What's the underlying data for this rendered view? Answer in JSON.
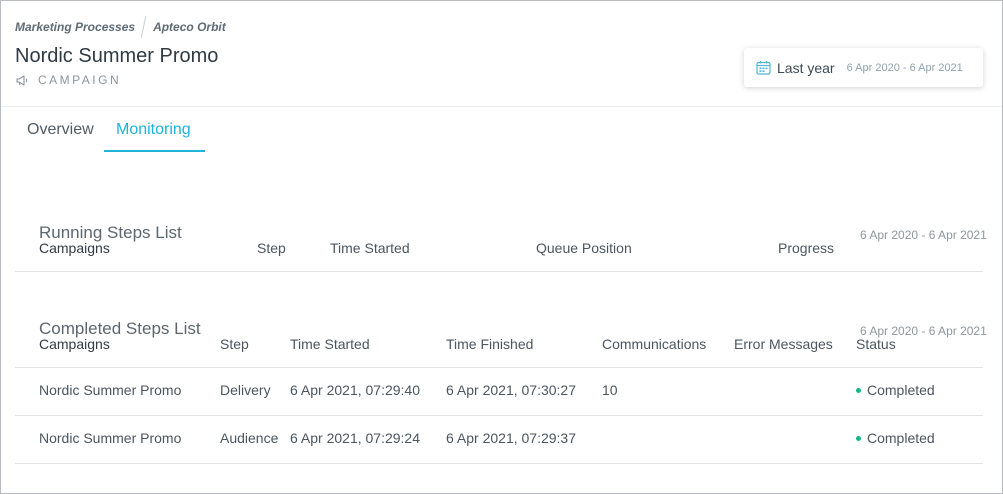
{
  "breadcrumb": [
    "Marketing Processes",
    "Apteco Orbit"
  ],
  "page": {
    "title": "Nordic Summer Promo",
    "type_label": "CAMPAIGN"
  },
  "date_filter": {
    "label": "Last year",
    "range": "6 Apr 2020 - 6 Apr 2021"
  },
  "tabs": [
    {
      "label": "Overview",
      "active": false
    },
    {
      "label": "Monitoring",
      "active": true
    }
  ],
  "running": {
    "title": "Running Steps List",
    "range": "6 Apr 2020 - 6 Apr 2021",
    "columns": [
      "Campaigns",
      "Step",
      "Time Started",
      "Queue Position",
      "Progress"
    ]
  },
  "completed": {
    "title": "Completed Steps List",
    "range": "6 Apr 2020 - 6 Apr 2021",
    "columns": [
      "Campaigns",
      "Step",
      "Time Started",
      "Time Finished",
      "Communications",
      "Error Messages",
      "Status"
    ],
    "rows": [
      {
        "campaign": "Nordic Summer Promo",
        "step": "Delivery",
        "time_started": "6 Apr 2021, 07:29:40",
        "time_finished": "6 Apr 2021, 07:30:27",
        "communications": "10",
        "error_messages": "",
        "status": "Completed"
      },
      {
        "campaign": "Nordic Summer Promo",
        "step": "Audience",
        "time_started": "6 Apr 2021, 07:29:24",
        "time_finished": "6 Apr 2021, 07:29:37",
        "communications": "",
        "error_messages": "",
        "status": "Completed"
      }
    ]
  },
  "colors": {
    "accent": "#1fb3d9",
    "status_completed": "#12b886"
  },
  "icons": {
    "campaign": "megaphone-icon",
    "date": "calendar-icon"
  }
}
